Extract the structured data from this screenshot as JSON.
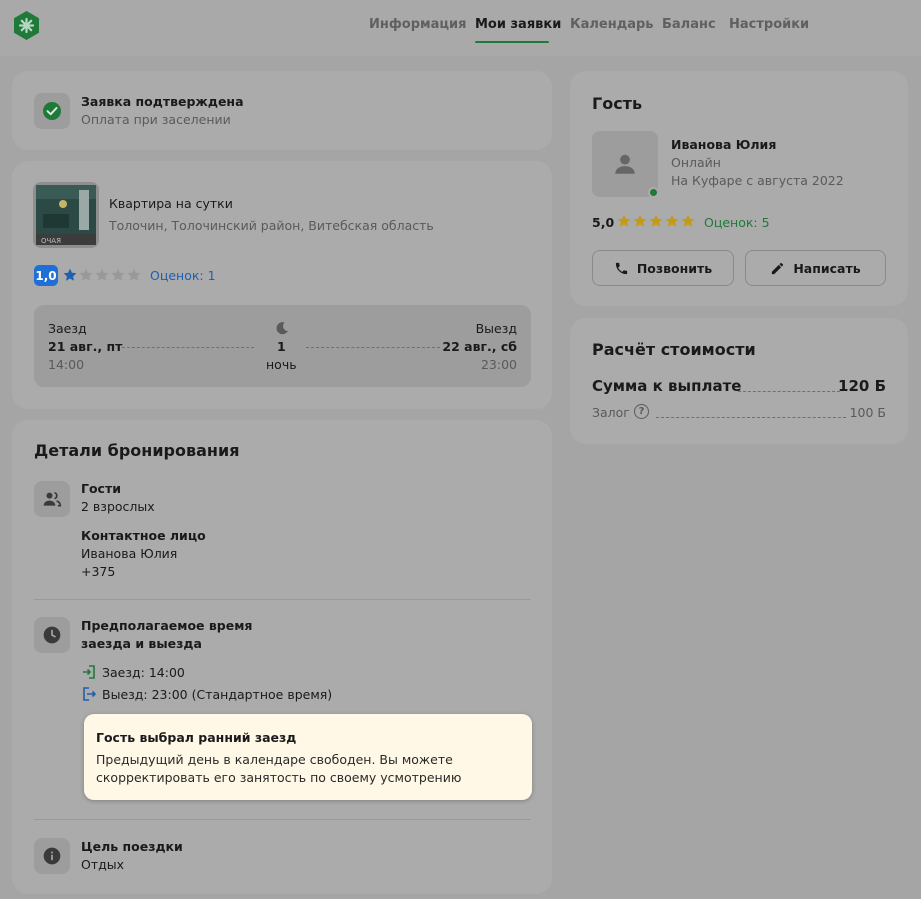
{
  "nav": {
    "items": [
      "Информация",
      "Мои заявки",
      "Календарь",
      "Баланс",
      "Настройки"
    ],
    "active_index": 1
  },
  "status": {
    "title": "Заявка подтверждена",
    "subtitle": "Оплата при заселении"
  },
  "listing": {
    "type": "Квартира на сутки",
    "address": "Толочин, Толочинский район, Витебская область",
    "rating": "1,0",
    "rating_stars": 1,
    "reviews": "Оценок: 1",
    "checkin_label": "Заезд",
    "checkin_date": "21 авг., пт",
    "checkin_time": "14:00",
    "nights_count": "1",
    "nights_label": "ночь",
    "checkout_label": "Выезд",
    "checkout_date": "22 авг., сб",
    "checkout_time": "23:00"
  },
  "details": {
    "title": "Детали бронирования",
    "guests_label": "Гости",
    "guests_value": "2 взрослых",
    "contact_label": "Контактное лицо",
    "contact_name": "Иванова Юлия",
    "contact_phone": "+375",
    "time_label_1": "Предполагаемое время",
    "time_label_2": "заезда и выезда",
    "checkin_line": "Заезд: 14:00",
    "checkout_line": "Выезд: 23:00 (Стандартное время)",
    "notice_title": "Гость выбрал ранний заезд",
    "notice_line_1": "Предыдущий день в календаре свободен. Вы можете",
    "notice_line_2": "скорректировать его занятость по своему усмотрению",
    "purpose_label": "Цель поездки",
    "purpose_value": "Отдых"
  },
  "guest": {
    "title": "Гость",
    "name": "Иванова Юлия",
    "status": "Онлайн",
    "since": "На Куфаре с августа 2022",
    "rating": "5,0",
    "rating_stars": 5,
    "reviews": "Оценок: 5",
    "call_label": "Позвонить",
    "message_label": "Написать"
  },
  "price": {
    "title": "Расчёт стоимости",
    "total_label": "Сумма к выплате",
    "total_value": "120 Б",
    "deposit_label": "Залог",
    "deposit_value": "100 Б"
  },
  "colors": {
    "accent_green": "#1f7a3a",
    "star_gold": "#c49a1a",
    "rating_badge": "#1f6fd6",
    "link_blue": "#1f5fb0",
    "notice_bg": "#fff8e7"
  }
}
